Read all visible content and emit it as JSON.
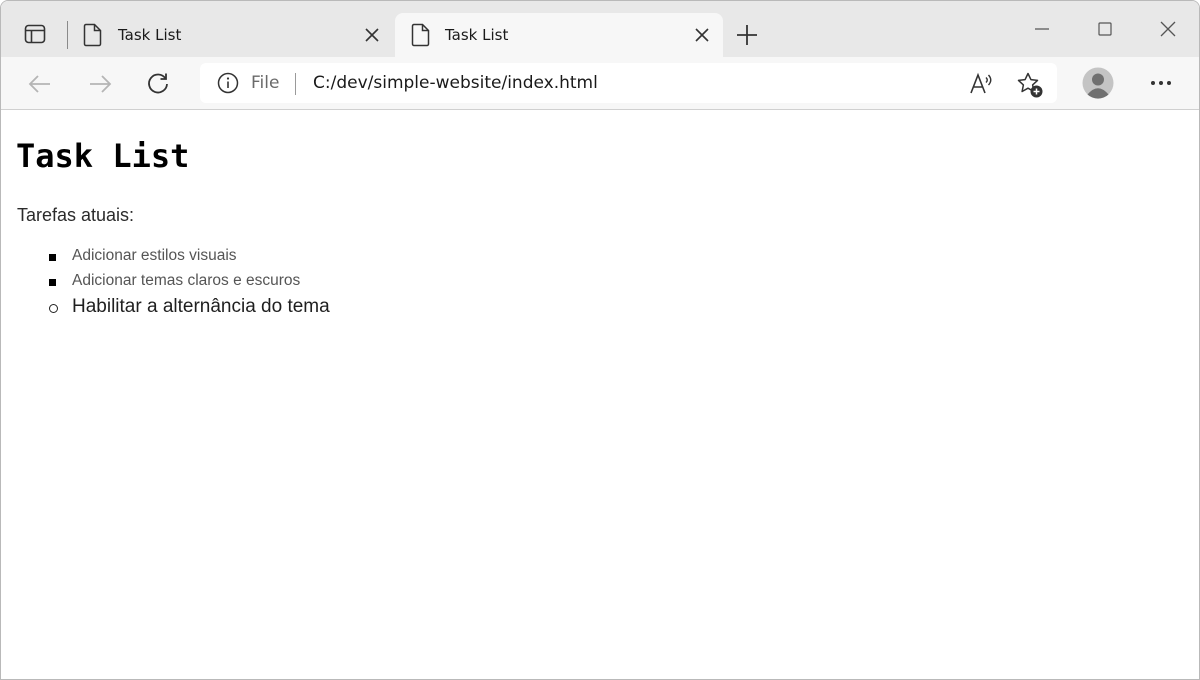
{
  "browser": {
    "tabs": [
      {
        "title": "Task List",
        "active": false
      },
      {
        "title": "Task List",
        "active": true
      }
    ],
    "address": {
      "scheme_label": "File",
      "url": "C:/dev/simple-website/index.html"
    },
    "icons": {
      "tab_actions": "tab-actions-icon",
      "page": "page-icon",
      "close": "close-icon",
      "new_tab": "plus-icon",
      "back": "back-arrow-icon",
      "forward": "forward-arrow-icon",
      "refresh": "refresh-icon",
      "info": "info-icon",
      "read_aloud": "read-aloud-icon",
      "favorites": "add-favorite-icon",
      "profile": "profile-icon",
      "more": "more-icon"
    }
  },
  "page": {
    "title": "Task List",
    "intro": "Tarefas atuais:",
    "tasks": [
      {
        "label": "Adicionar estilos visuais",
        "status": "done"
      },
      {
        "label": "Adicionar temas claros e escuros",
        "status": "done"
      },
      {
        "label": "Habilitar a alternância do tema",
        "status": "pending"
      }
    ]
  }
}
